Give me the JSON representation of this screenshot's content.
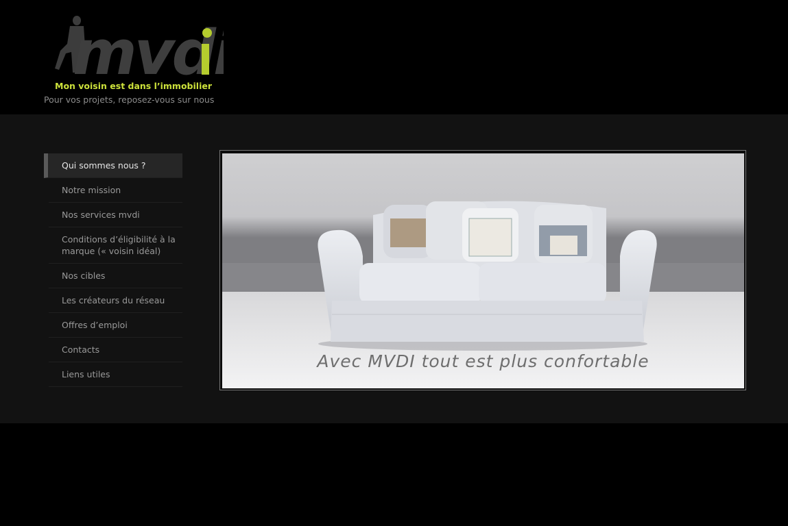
{
  "site": {
    "logo_text": "mvdi",
    "tagline": "Mon voisin est dans l’immobilier",
    "slogan": "Pour vos projets, reposez-vous sur nous"
  },
  "colors": {
    "brand_green": "#b5cc2e",
    "logo_gray": "#404040",
    "page_bg": "#000000",
    "content_bg": "#121212"
  },
  "nav": {
    "items": [
      {
        "label": "Qui sommes nous ?",
        "active": true
      },
      {
        "label": "Notre mission"
      },
      {
        "label": "Nos services mvdi"
      },
      {
        "label": "Conditions d’éligibilité à la marque (« voisin idéal)"
      },
      {
        "label": "Nos cibles"
      },
      {
        "label": "Les créateurs du réseau"
      },
      {
        "label": "Offres d’emploi"
      },
      {
        "label": "Contacts"
      },
      {
        "label": "Liens utiles"
      }
    ]
  },
  "banner": {
    "caption": "Avec MVDI tout est plus confortable"
  }
}
